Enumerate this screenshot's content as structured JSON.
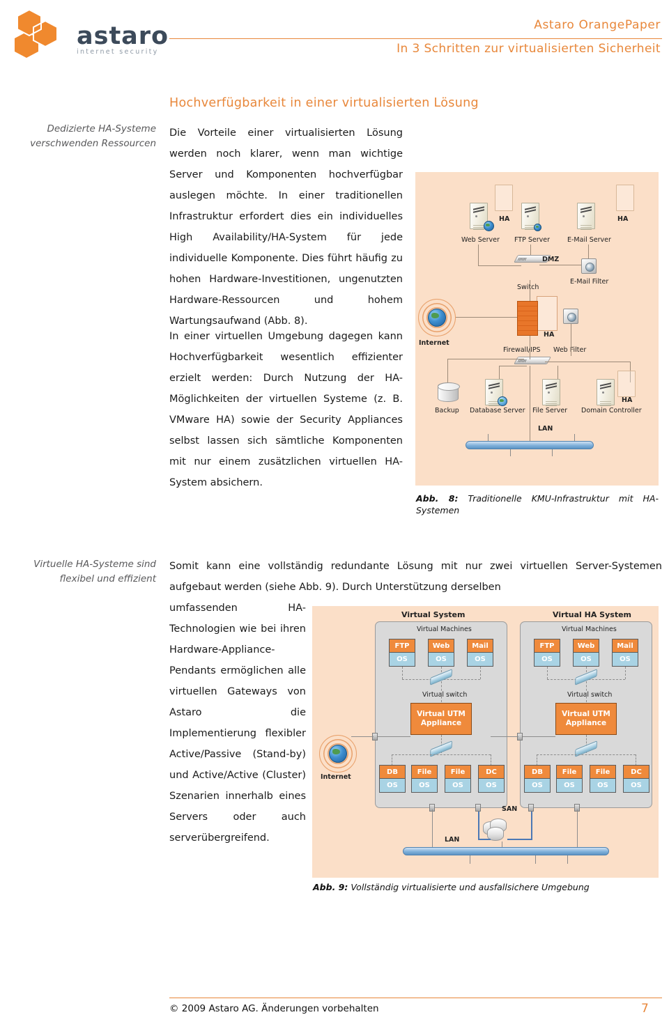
{
  "header": {
    "logo_name": "astaro",
    "logo_tagline": "internet security",
    "title": "Astaro OrangePaper",
    "subtitle": "In 3 Schritten zur virtualisierten Sicherheit"
  },
  "section": {
    "title": "Hochverfügbarkeit in einer virtualisierten Lösung"
  },
  "margin_notes": {
    "note1": "Dedizierte HA-Systeme verschwenden Ressourcen",
    "note2": "Virtuelle HA-Systeme sind flexibel und effizient"
  },
  "paragraphs": {
    "p1": "Die Vorteile einer virtualisierten Lösung werden noch klarer, wenn man wichtige Server und Komponenten hochverfügbar auslegen möchte. In einer traditionellen Infrastruktur erfordert dies ein individuelles High Availability/HA-System für jede individuelle Komponente. Dies führt häufig zu hohen Hardware-Investitionen, ungenutzten Hardware-Ressourcen und hohem Wartungsaufwand (Abb. 8).",
    "p2": "In einer virtuellen Umgebung dagegen kann Hochverfügbarkeit wesentlich effizienter erzielt werden: Durch Nutzung der HA-Möglichkeiten der virtuellen Systeme (z. B. VMware HA) sowie der Security Appliances selbst lassen sich sämtliche Komponenten mit nur einem zusätzlichen virtuellen HA-System absichern.",
    "p3": "Somit kann eine vollständig redundante Lösung mit nur zwei virtuellen Server-Systemen aufgebaut werden (siehe Abb. 9). Durch Unterstützung derselben",
    "p4": "umfassenden HA-Technologien wie bei ihren Hardware-Appliance-Pendants ermöglichen alle virtuellen Gateways von Astaro die Implementierung flexibler Active/Passive (Stand-by) und Active/Active (Cluster) Szenarien innerhalb eines Servers oder auch serverübergreifend."
  },
  "figures": {
    "fig8": {
      "caption_label": "Abb. 8:",
      "caption_text": "Traditionelle KMU-Infrastruktur mit HA-Systemen",
      "labels": {
        "web_server": "Web Server",
        "ftp_server": "FTP Server",
        "email_server": "E-Mail Server",
        "email_filter": "E-Mail Filter",
        "dmz": "DMZ",
        "switch": "Switch",
        "internet": "Internet",
        "firewall_ips": "Firewall/IPS",
        "web_filter": "Web Filter",
        "backup": "Backup",
        "database_server": "Database Server",
        "file_server": "File Server",
        "domain_controller": "Domain Controller",
        "lan": "LAN",
        "ha": "HA"
      }
    },
    "fig9": {
      "caption_label": "Abb. 9:",
      "caption_text": "Vollständig virtualisierte und ausfallsichere Umgebung",
      "labels": {
        "virtual_system": "Virtual System",
        "virtual_ha_system": "Virtual HA System",
        "virtual_machines": "Virtual Machines",
        "virtual_switch": "Virtual switch",
        "virtual_utm_appliance": "Virtual UTM Appliance",
        "internet": "Internet",
        "san": "SAN",
        "lan": "LAN",
        "os": "OS",
        "ftp": "FTP",
        "web": "Web",
        "mail": "Mail",
        "db": "DB",
        "file": "File",
        "dc": "DC"
      }
    }
  },
  "footer": {
    "copyright": "© 2009 Astaro AG. Änderungen vorbehalten",
    "page_number": "7"
  },
  "colors": {
    "accent_orange": "#E8873A",
    "diagram_bg": "#FBDFC8",
    "logo_text": "#3C4A5A",
    "vm_top": "#EF8A3C",
    "vm_bottom": "#A9D3E4"
  }
}
